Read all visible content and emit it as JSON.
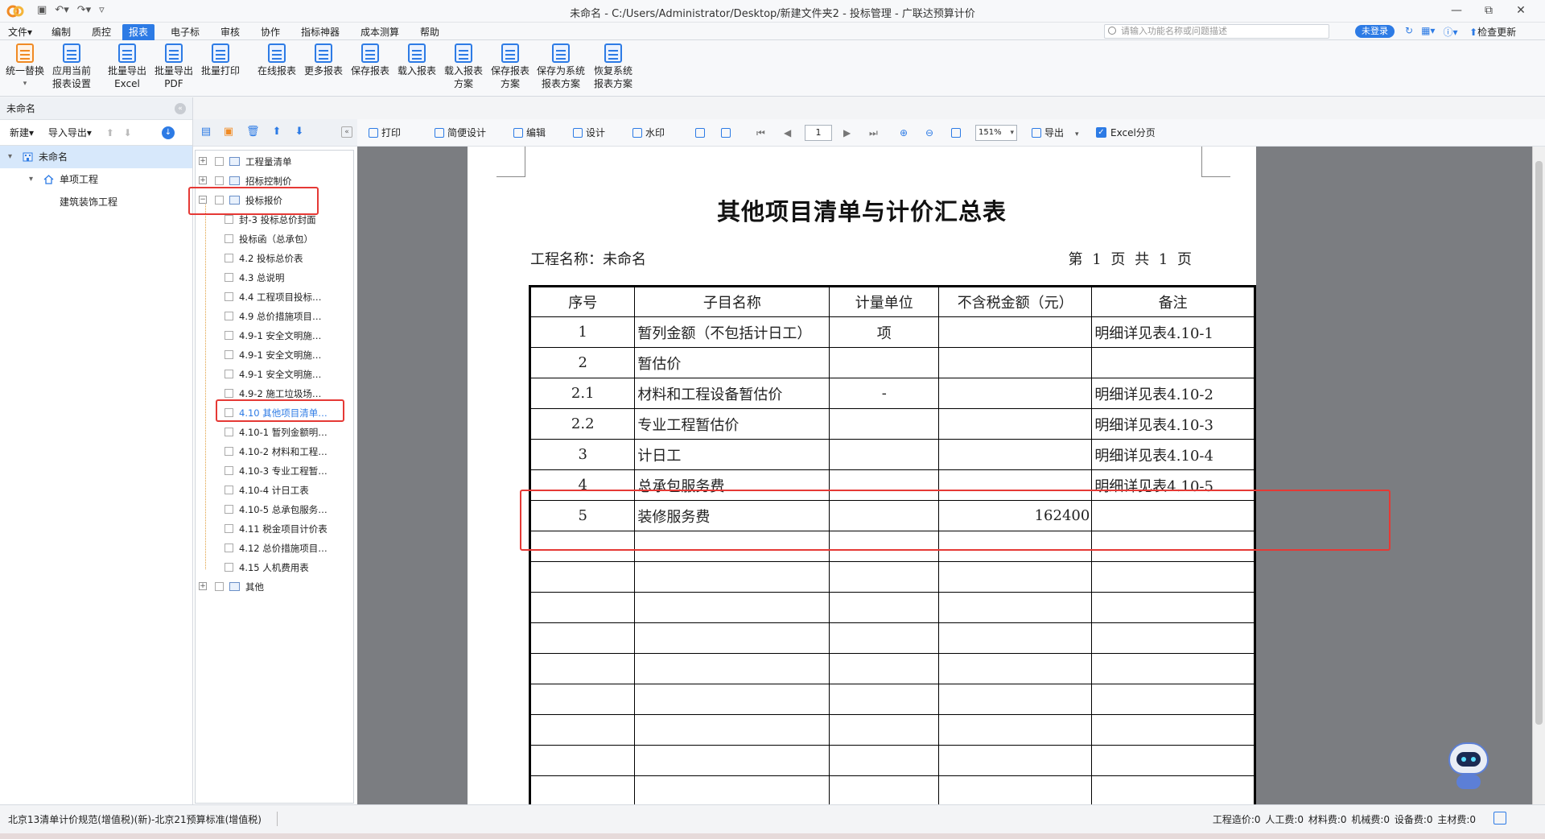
{
  "window": {
    "title": "未命名 - C:/Users/Administrator/Desktop/新建文件夹2 - 投标管理 - 广联达预算计价",
    "controls": [
      "—",
      "⧉",
      "✕"
    ]
  },
  "menu": {
    "items": [
      "文件▾",
      "编制",
      "质控",
      "报表",
      "电子标",
      "审核",
      "协作",
      "指标神器",
      "成本测算",
      "帮助"
    ],
    "active_index": 3,
    "search_placeholder": "请输入功能名称或问题描述",
    "login_label": "未登录",
    "update_label": "检查更新"
  },
  "ribbon": {
    "buttons": [
      {
        "line1": "统一替换",
        "line2": "▾",
        "icon": "replace-icon"
      },
      {
        "line1": "应用当前",
        "line2": "报表设置",
        "icon": "apply-settings-icon"
      },
      {
        "line1": "批量导出",
        "line2": "Excel",
        "icon": "excel-export-icon"
      },
      {
        "line1": "批量导出",
        "line2": "PDF",
        "icon": "pdf-export-icon"
      },
      {
        "line1": "批量打印",
        "line2": "",
        "icon": "print-icon"
      },
      {
        "line1": "在线报表",
        "line2": "",
        "icon": "online-report-icon"
      },
      {
        "line1": "更多报表",
        "line2": "",
        "icon": "more-reports-icon"
      },
      {
        "line1": "保存报表",
        "line2": "",
        "icon": "save-report-icon"
      },
      {
        "line1": "载入报表",
        "line2": "",
        "icon": "load-report-icon"
      },
      {
        "line1": "载入报表",
        "line2": "方案",
        "icon": "load-scheme-icon"
      },
      {
        "line1": "保存报表",
        "line2": "方案",
        "icon": "save-scheme-icon"
      },
      {
        "line1": "保存为系统",
        "line2": "报表方案",
        "icon": "save-system-scheme-icon"
      },
      {
        "line1": "恢复系统",
        "line2": "报表方案",
        "icon": "restore-system-scheme-icon"
      }
    ]
  },
  "project_panel": {
    "header": "未命名",
    "tools": {
      "new": "新建▾",
      "import_export": "导入导出▾"
    },
    "tree": [
      {
        "label": "未命名",
        "level": 0,
        "toggle": "▾",
        "selected": true
      },
      {
        "label": "单项工程",
        "level": 1,
        "toggle": "▾",
        "selected": false
      },
      {
        "label": "建筑装饰工程",
        "level": 2,
        "toggle": "",
        "selected": false
      }
    ]
  },
  "report_tree": {
    "items": [
      {
        "label": "工程量清单",
        "level": 0,
        "toggle": "+"
      },
      {
        "label": "招标控制价",
        "level": 0,
        "toggle": "+"
      },
      {
        "label": "投标报价",
        "level": 0,
        "toggle": "−"
      },
      {
        "label": "封-3 投标总价封面",
        "level": 1
      },
      {
        "label": "投标函（总承包）",
        "level": 1
      },
      {
        "label": "4.2 投标总价表",
        "level": 1
      },
      {
        "label": "4.3 总说明",
        "level": 1
      },
      {
        "label": "4.4 工程项目投标…",
        "level": 1
      },
      {
        "label": "4.9 总价措施项目…",
        "level": 1
      },
      {
        "label": "4.9-1 安全文明施…",
        "level": 1
      },
      {
        "label": "4.9-1 安全文明施…",
        "level": 1
      },
      {
        "label": "4.9-1 安全文明施…",
        "level": 1
      },
      {
        "label": "4.9-2 施工垃圾场…",
        "level": 1
      },
      {
        "label": "4.10 其他项目清单…",
        "level": 1,
        "highlight": true
      },
      {
        "label": "4.10-1 暂列金额明…",
        "level": 1
      },
      {
        "label": "4.10-2 材料和工程…",
        "level": 1
      },
      {
        "label": "4.10-3 专业工程暂…",
        "level": 1
      },
      {
        "label": "4.10-4 计日工表",
        "level": 1
      },
      {
        "label": "4.10-5 总承包服务…",
        "level": 1
      },
      {
        "label": "4.11 税金项目计价表",
        "level": 1
      },
      {
        "label": "4.12 总价措施项目…",
        "level": 1
      },
      {
        "label": "4.15 人机费用表",
        "level": 1
      },
      {
        "label": "其他",
        "level": 0,
        "toggle": "+"
      }
    ]
  },
  "viewer_toolbar": {
    "print": "打印",
    "simple_design": "简便设计",
    "edit": "编辑",
    "design": "设计",
    "watermark": "水印",
    "page": "1",
    "zoom": "151%",
    "export": "导出",
    "excel_paging": "Excel分页"
  },
  "report": {
    "title": "其他项目清单与计价汇总表",
    "project_name": "工程名称：未命名",
    "page_info": "第 1 页  共 1 页",
    "columns": [
      "序号",
      "子目名称",
      "计量单位",
      "不含税金额（元）",
      "备注"
    ],
    "rows": [
      [
        "1",
        "暂列金额（不包括计日工）",
        "项",
        "",
        "明细详见表4.10-1"
      ],
      [
        "2",
        "暂估价",
        "",
        "",
        ""
      ],
      [
        "2.1",
        "材料和工程设备暂估价",
        "-",
        "",
        "明细详见表4.10-2"
      ],
      [
        "2.2",
        "专业工程暂估价",
        "",
        "",
        "明细详见表4.10-3"
      ],
      [
        "3",
        "计日工",
        "",
        "",
        "明细详见表4.10-4"
      ],
      [
        "4",
        "总承包服务费",
        "",
        "",
        "明细详见表4.10-5"
      ],
      [
        "5",
        "装修服务费",
        "",
        "162400",
        ""
      ],
      [
        "",
        "",
        "",
        "",
        ""
      ],
      [
        "",
        "",
        "",
        "",
        ""
      ],
      [
        "",
        "",
        "",
        "",
        ""
      ],
      [
        "",
        "",
        "",
        "",
        ""
      ],
      [
        "",
        "",
        "",
        "",
        ""
      ],
      [
        "",
        "",
        "",
        "",
        ""
      ],
      [
        "",
        "",
        "",
        "",
        ""
      ],
      [
        "",
        "",
        "",
        "",
        ""
      ],
      [
        "",
        "",
        "",
        "",
        ""
      ],
      [
        "",
        "",
        "",
        "",
        ""
      ]
    ]
  },
  "status": {
    "left": "北京13清单计价规范(增值税)(新)-北京21预算标准(增值税)",
    "right": "工程造价:0  人工费:0  材料费:0  机械费:0  设备费:0  主材费:0"
  }
}
